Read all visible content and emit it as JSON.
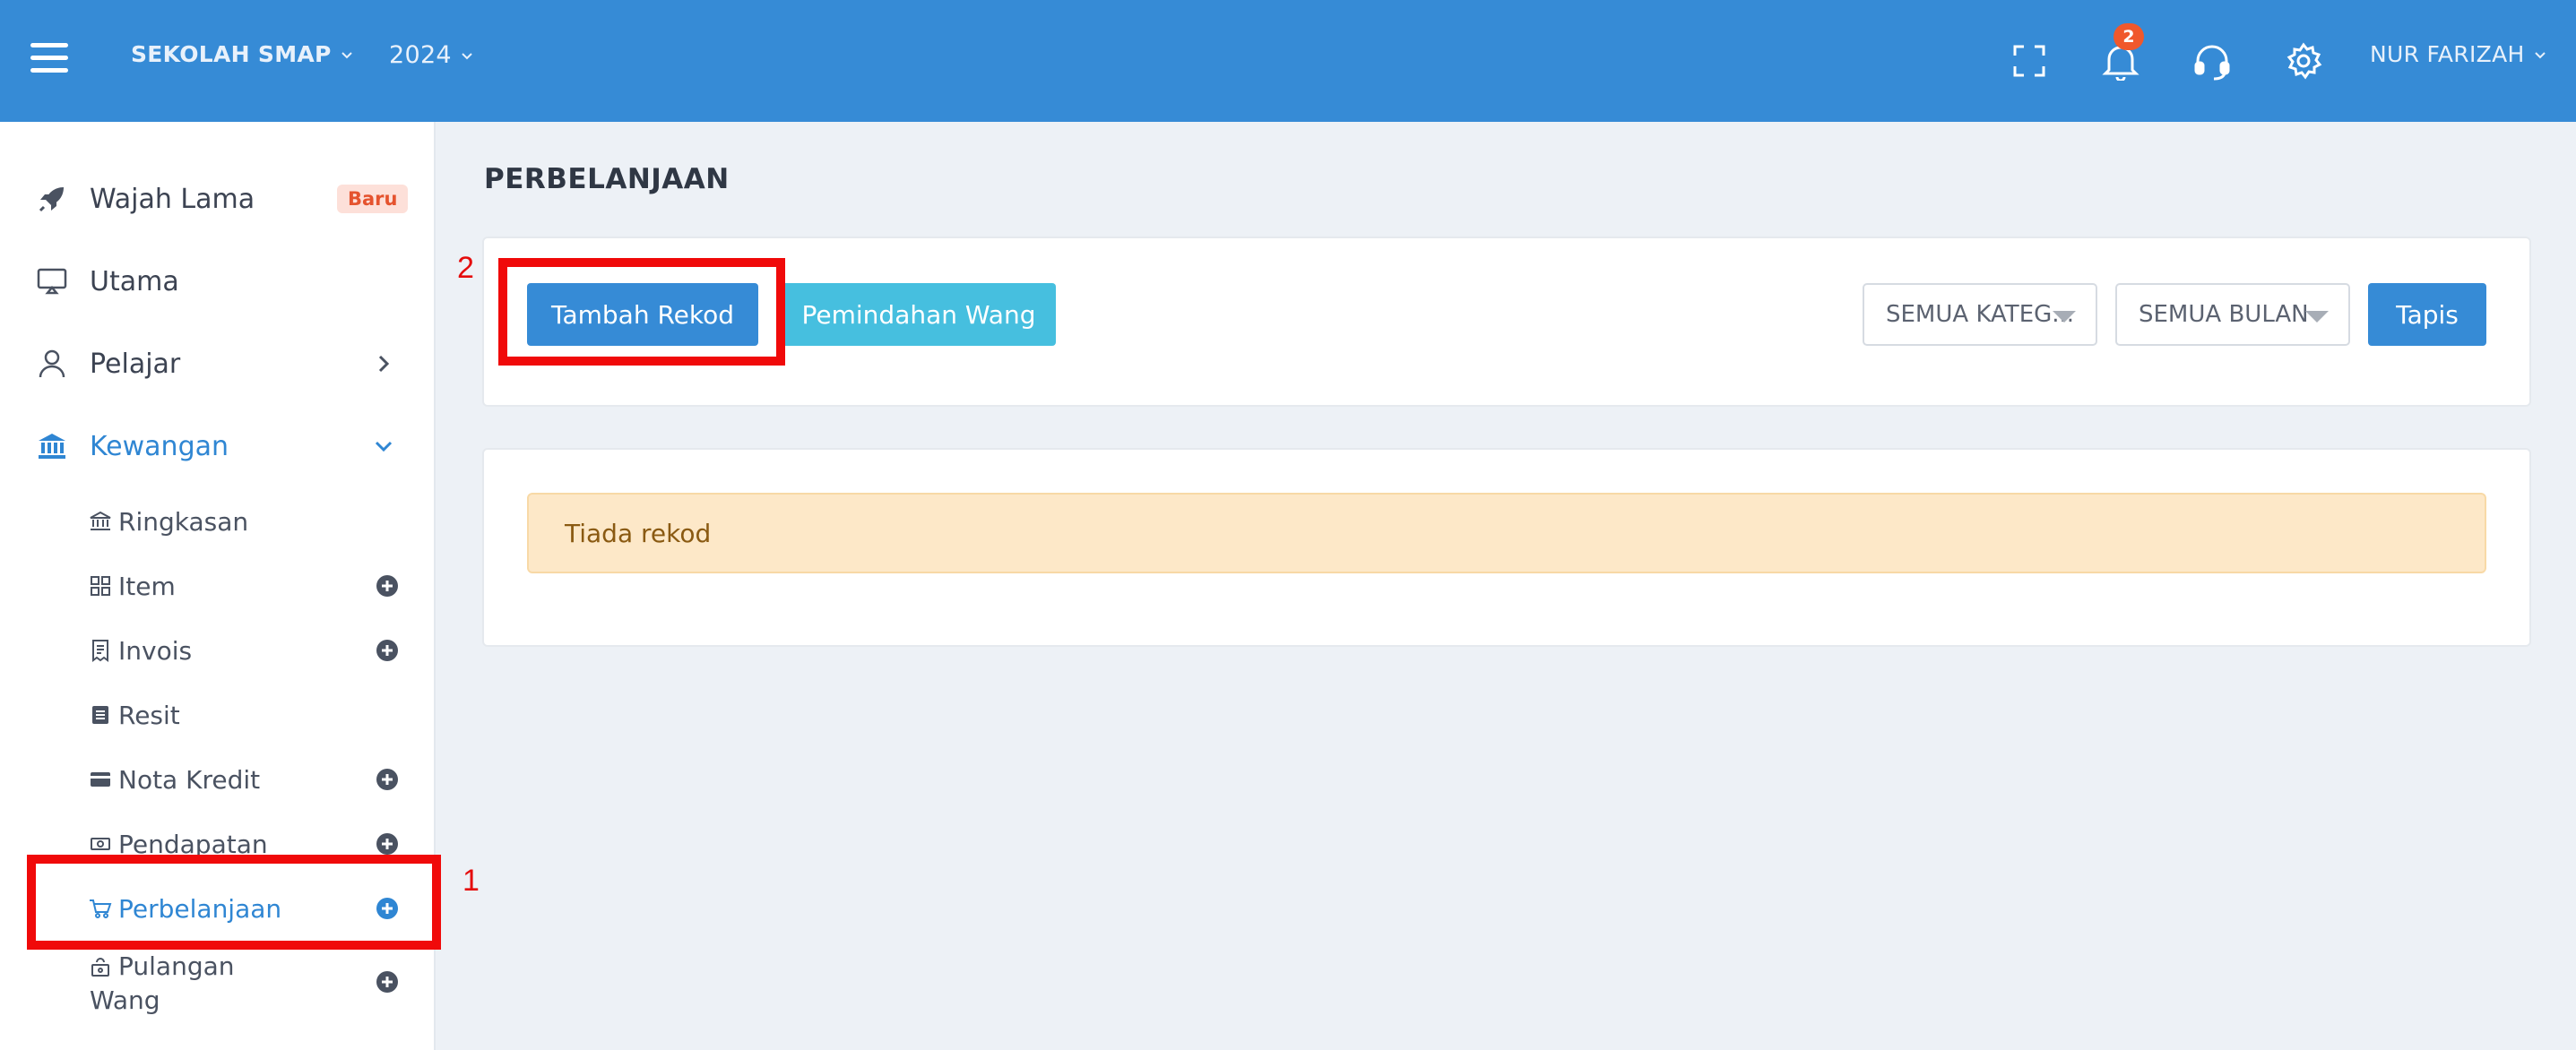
{
  "topbar": {
    "school": "SEKOLAH SMAP",
    "year": "2024",
    "notification_count": "2",
    "user": "NUR FARIZAH"
  },
  "sidebar": {
    "items": [
      {
        "label": "Wajah Lama",
        "badge": "Baru",
        "icon": "rocket-icon"
      },
      {
        "label": "Utama",
        "icon": "monitor-icon"
      },
      {
        "label": "Pelajar",
        "icon": "user-icon"
      },
      {
        "label": "Kewangan",
        "icon": "bank-icon"
      }
    ],
    "sub_items": [
      {
        "label": "Ringkasan",
        "icon": "bank-small-icon"
      },
      {
        "label": "Item",
        "icon": "grid-icon"
      },
      {
        "label": "Invois",
        "icon": "invoice-icon"
      },
      {
        "label": "Resit",
        "icon": "receipt-icon"
      },
      {
        "label": "Nota Kredit",
        "icon": "card-icon"
      },
      {
        "label": "Pendapatan",
        "icon": "cash-icon"
      },
      {
        "label": "Perbelanjaan",
        "icon": "cart-icon"
      },
      {
        "label": "Pulangan",
        "label2": "Wang",
        "icon": "refund-icon"
      }
    ]
  },
  "main": {
    "title": "PERBELANJAAN",
    "add_button": "Tambah Rekod",
    "transfer_button": "Pemindahan Wang",
    "category_select": "SEMUA KATEG...",
    "month_select": "SEMUA BULAN",
    "filter_button": "Tapis",
    "empty_message": "Tiada rekod"
  },
  "annotations": {
    "label_1": "1",
    "label_2": "2"
  },
  "colors": {
    "primary": "#368bd6",
    "info": "#46bfdf",
    "annotation": "#f00a0a",
    "badge": "#f0582c"
  }
}
